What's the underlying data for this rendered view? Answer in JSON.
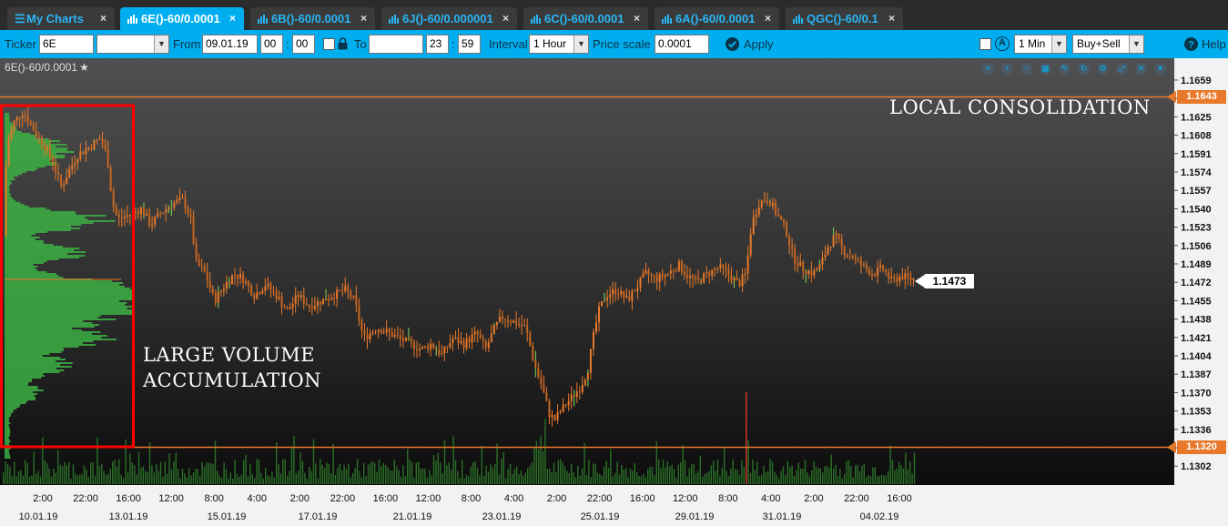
{
  "tabs": [
    {
      "label": "My Charts",
      "active": false
    },
    {
      "label": "6E()-60/0.0001",
      "active": true
    },
    {
      "label": "6B()-60/0.0001",
      "active": false
    },
    {
      "label": "6J()-60/0.000001",
      "active": false
    },
    {
      "label": "6C()-60/0.0001",
      "active": false
    },
    {
      "label": "6A()-60/0.0001",
      "active": false
    },
    {
      "label": "QGC()-60/0.1",
      "active": false
    }
  ],
  "close_glyph": "×",
  "toolbar": {
    "ticker_label": "Ticker",
    "ticker_value": "6E",
    "ticker_select_value": "",
    "from_label": "From",
    "from_date": "09.01.19",
    "from_hour": "00",
    "from_min": "00",
    "to_label": "To",
    "to_date": "",
    "to_hour": "23",
    "to_min": "59",
    "interval_label": "Interval",
    "interval_value": "1 Hour",
    "price_scale_label": "Price scale",
    "price_scale_value": "0.0001",
    "apply_label": "Apply",
    "auto_icon_text": "A",
    "timeframe_value": "1 Min",
    "side_value": "Buy+Sell",
    "help_label": "Help",
    "time_separator": ":"
  },
  "chart": {
    "title": "6E()-60/0.0001",
    "star_glyph": "★",
    "annotation_volume_line1": "LARGE VOLUME",
    "annotation_volume_line2": "ACCUMULATION",
    "annotation_consolidation": "LOCAL CONSOLIDATION",
    "last_price": "1.1473",
    "upper_level": "1.1643",
    "lower_level": "1.1320",
    "tools": [
      "zoom-fit-icon",
      "zoom-in-icon",
      "zoom-out-icon",
      "grid-icon",
      "pencil-icon",
      "refresh-icon",
      "settings-icon",
      "popout-icon",
      "close-icon",
      "menu-icon"
    ],
    "colors": {
      "candle_up": "#e8792a",
      "candle_down": "#c9661f",
      "profile": "#3cb043",
      "level": "#e8792a",
      "highlight_box": "#ff0000",
      "accent": "#00aeef"
    }
  },
  "chart_data": {
    "type": "candlestick",
    "price_ticks": [
      "1.1659",
      "1.1642",
      "1.1625",
      "1.1608",
      "1.1591",
      "1.1574",
      "1.1557",
      "1.1540",
      "1.1523",
      "1.1506",
      "1.1489",
      "1.1472",
      "1.1455",
      "1.1438",
      "1.1421",
      "1.1404",
      "1.1387",
      "1.1370",
      "1.1353",
      "1.1336",
      "1.1319",
      "1.1302"
    ],
    "hidden_ticks": [
      "1.1642",
      "1.1319"
    ],
    "time_ticks": [
      "2:00",
      "22:00",
      "16:00",
      "12:00",
      "8:00",
      "4:00",
      "2:00",
      "22:00",
      "16:00",
      "12:00",
      "8:00",
      "4:00",
      "2:00",
      "22:00",
      "16:00",
      "12:00",
      "8:00",
      "4:00",
      "2:00",
      "22:00",
      "16:00"
    ],
    "date_ticks": [
      "10.01.19",
      "13.01.19",
      "15.01.19",
      "17.01.19",
      "21.01.19",
      "23.01.19",
      "25.01.19",
      "29.01.19",
      "31.01.19",
      "04.02.19"
    ],
    "price_path": [
      [
        1.1515,
        0
      ],
      [
        1.16,
        4
      ],
      [
        1.162,
        12
      ],
      [
        1.163,
        22
      ],
      [
        1.1615,
        32
      ],
      [
        1.16,
        44
      ],
      [
        1.1585,
        54
      ],
      [
        1.156,
        64
      ],
      [
        1.1575,
        72
      ],
      [
        1.159,
        82
      ],
      [
        1.1598,
        96
      ],
      [
        1.1605,
        106
      ],
      [
        1.159,
        114
      ],
      [
        1.1545,
        120
      ],
      [
        1.153,
        126
      ],
      [
        1.1535,
        140
      ],
      [
        1.154,
        152
      ],
      [
        1.1525,
        162
      ],
      [
        1.1535,
        172
      ],
      [
        1.1545,
        186
      ],
      [
        1.1548,
        198
      ],
      [
        1.153,
        206
      ],
      [
        1.149,
        212
      ],
      [
        1.148,
        222
      ],
      [
        1.1455,
        232
      ],
      [
        1.147,
        244
      ],
      [
        1.148,
        254
      ],
      [
        1.1475,
        264
      ],
      [
        1.146,
        276
      ],
      [
        1.147,
        288
      ],
      [
        1.146,
        300
      ],
      [
        1.1445,
        312
      ],
      [
        1.146,
        324
      ],
      [
        1.145,
        336
      ],
      [
        1.1455,
        350
      ],
      [
        1.146,
        362
      ],
      [
        1.1465,
        376
      ],
      [
        1.1455,
        386
      ],
      [
        1.142,
        396
      ],
      [
        1.143,
        410
      ],
      [
        1.1425,
        424
      ],
      [
        1.142,
        436
      ],
      [
        1.1415,
        448
      ],
      [
        1.141,
        460
      ],
      [
        1.1415,
        470
      ],
      [
        1.1405,
        482
      ],
      [
        1.142,
        494
      ],
      [
        1.1415,
        506
      ],
      [
        1.1425,
        520
      ],
      [
        1.141,
        530
      ],
      [
        1.143,
        540
      ],
      [
        1.144,
        548
      ],
      [
        1.1435,
        562
      ],
      [
        1.143,
        574
      ],
      [
        1.1395,
        584
      ],
      [
        1.1375,
        592
      ],
      [
        1.135,
        600
      ],
      [
        1.1345,
        606
      ],
      [
        1.1355,
        614
      ],
      [
        1.1365,
        624
      ],
      [
        1.1375,
        634
      ],
      [
        1.139,
        642
      ],
      [
        1.142,
        648
      ],
      [
        1.1445,
        654
      ],
      [
        1.146,
        662
      ],
      [
        1.1465,
        674
      ],
      [
        1.1455,
        686
      ],
      [
        1.1468,
        696
      ],
      [
        1.148,
        706
      ],
      [
        1.1475,
        718
      ],
      [
        1.148,
        730
      ],
      [
        1.1488,
        742
      ],
      [
        1.1478,
        752
      ],
      [
        1.1472,
        762
      ],
      [
        1.148,
        774
      ],
      [
        1.1486,
        786
      ],
      [
        1.148,
        796
      ],
      [
        1.147,
        808
      ],
      [
        1.148,
        816
      ],
      [
        1.1525,
        822
      ],
      [
        1.1545,
        830
      ],
      [
        1.155,
        840
      ],
      [
        1.1535,
        850
      ],
      [
        1.152,
        860
      ],
      [
        1.1495,
        868
      ],
      [
        1.1485,
        878
      ],
      [
        1.148,
        890
      ],
      [
        1.1488,
        898
      ],
      [
        1.1505,
        906
      ],
      [
        1.1515,
        914
      ],
      [
        1.15,
        924
      ],
      [
        1.1495,
        934
      ],
      [
        1.1485,
        946
      ],
      [
        1.148,
        956
      ],
      [
        1.1485,
        966
      ],
      [
        1.1473,
        976
      ],
      [
        1.1478,
        986
      ],
      [
        1.1475,
        996
      ]
    ]
  }
}
